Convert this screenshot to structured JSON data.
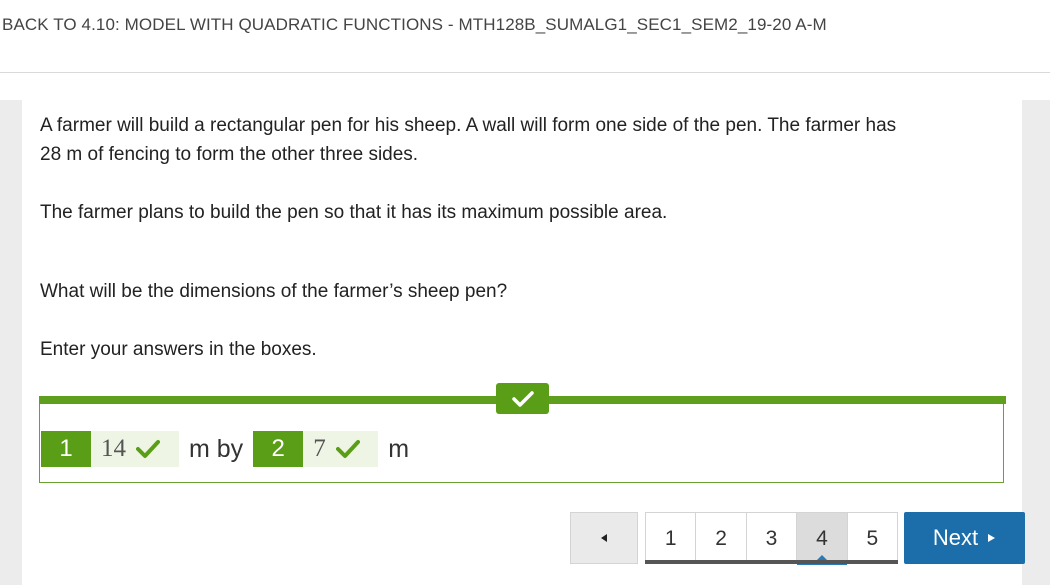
{
  "header": {
    "back_link": "BACK TO 4.10: MODEL WITH QUADRATIC FUNCTIONS - MTH128B_SUMALG1_SEC1_SEM2_19-20 A-M"
  },
  "question": {
    "para1_line1": "A farmer will build a rectangular pen for his sheep. A wall will form one side of the pen. The farmer has",
    "para1_line2": "28 m of fencing to form the other three sides.",
    "para2": "The farmer plans to build the pen so that it has its maximum possible area.",
    "para3": "What will be the dimensions of the farmer’s sheep pen?",
    "para4": "Enter your answers in the boxes."
  },
  "answer": {
    "status": "correct",
    "accent_color": "#5a9e17",
    "boxes": [
      {
        "index": "1",
        "value": "14",
        "icon": "check-icon"
      },
      {
        "index": "2",
        "value": "7",
        "icon": "check-icon"
      }
    ],
    "unit1": "m by",
    "unit2": "m"
  },
  "pager": {
    "prev_icon": "triangle-left-icon",
    "pages": [
      "1",
      "2",
      "3",
      "4",
      "5"
    ],
    "current": "4",
    "next_label": "Next",
    "next_icon": "triangle-right-icon",
    "next_color": "#1b6ea9"
  }
}
